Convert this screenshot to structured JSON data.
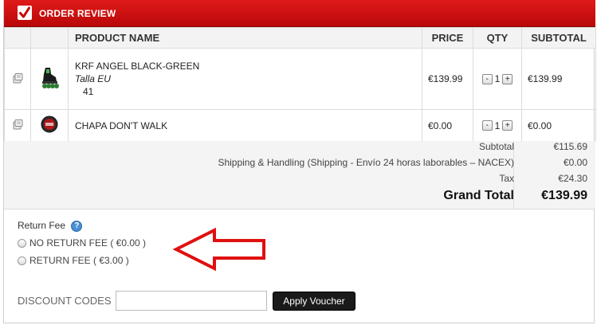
{
  "header": {
    "title": "ORDER REVIEW"
  },
  "columns": {
    "product": "PRODUCT NAME",
    "price": "PRICE",
    "qty": "QTY",
    "subtotal": "SUBTOTAL"
  },
  "items": [
    {
      "name": "KRF ANGEL BLACK-GREEN",
      "attr_label": "Talla EU",
      "attr_value": "41",
      "price": "€139.99",
      "qty": "1",
      "subtotal": "€139.99",
      "image_icon": "inline-skate-icon"
    },
    {
      "name": "CHAPA DON'T WALK",
      "price": "€0.00",
      "qty": "1",
      "subtotal": "€0.00",
      "image_icon": "badge-pin-icon"
    }
  ],
  "qty_controls": {
    "minus": "-",
    "plus": "+"
  },
  "totals": {
    "subtotal_label": "Subtotal",
    "subtotal_value": "€115.69",
    "shipping_label": "Shipping & Handling (Shipping - Envío 24 horas laborables – NACEX)",
    "shipping_value": "€0.00",
    "tax_label": "Tax",
    "tax_value": "€24.30",
    "grand_label": "Grand Total",
    "grand_value": "€139.99"
  },
  "return_fee": {
    "label": "Return Fee",
    "help": "?",
    "options": [
      "NO RETURN FEE ( €0.00 )",
      "RETURN FEE ( €3.00 )"
    ]
  },
  "discount": {
    "label": "DISCOUNT CODES",
    "value": "",
    "button": "Apply Voucher"
  },
  "colors": {
    "header": "#c80f0f",
    "arrow": "#e01010",
    "button": "#1a1a1a"
  }
}
